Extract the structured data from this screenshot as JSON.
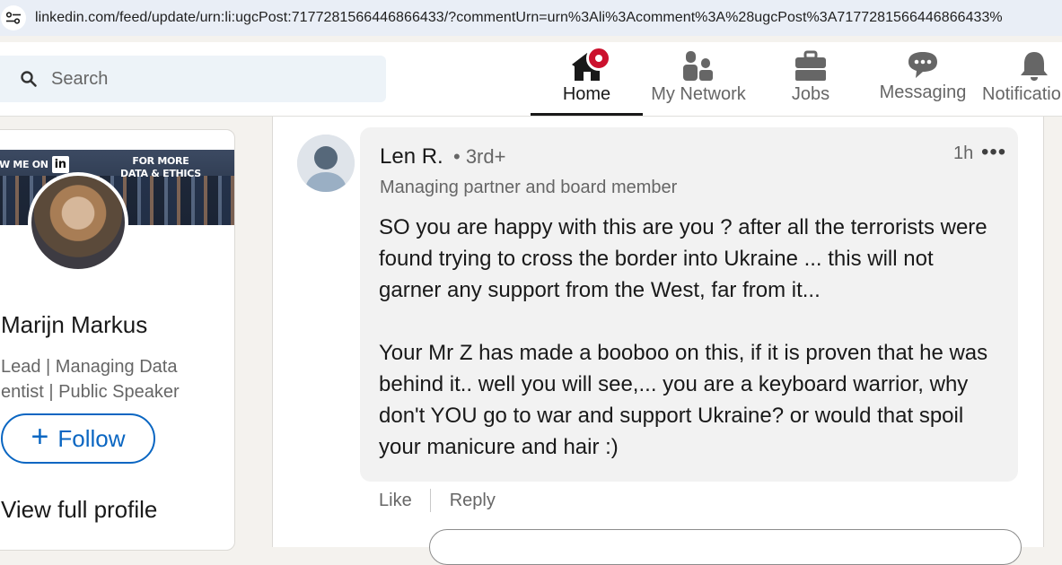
{
  "browser": {
    "url": "linkedin.com/feed/update/urn:li:ugcPost:7177281566446866433/?commentUrn=urn%3Ali%3Acomment%3A%28ugcPost%3A7177281566446866433%"
  },
  "search": {
    "placeholder": "Search"
  },
  "nav": {
    "home": "Home",
    "network": "My Network",
    "jobs": "Jobs",
    "messaging": "Messaging",
    "notifications": "Notifications"
  },
  "profile": {
    "banner_left": "W ME ON",
    "banner_li": "in",
    "banner_right_1": "FOR MORE",
    "banner_right_2": "DATA & ETHICS",
    "name": "Marijn Markus",
    "headline_1": "Lead | Managing Data",
    "headline_2": "entist | Public Speaker",
    "follow": "Follow",
    "view_profile": "View full profile"
  },
  "comment": {
    "author": "Len R.",
    "degree": "• 3rd+",
    "time": "1h",
    "more": "•••",
    "headline": "Managing partner and board member",
    "body": "SO you are happy with this are you ? after all the terrorists were found trying to cross the border into Ukraine ... this will not garner any support from the West, far from it...\n\nYour Mr Z has made a booboo on this, if it is proven that he was behind it.. well you will see,... you are a keyboard warrior, why don't YOU go to war and support Ukraine? or would that spoil your manicure and hair :)",
    "like": "Like",
    "reply": "Reply"
  },
  "colors": {
    "accent": "#0a66c2",
    "badge": "#cb112d"
  }
}
